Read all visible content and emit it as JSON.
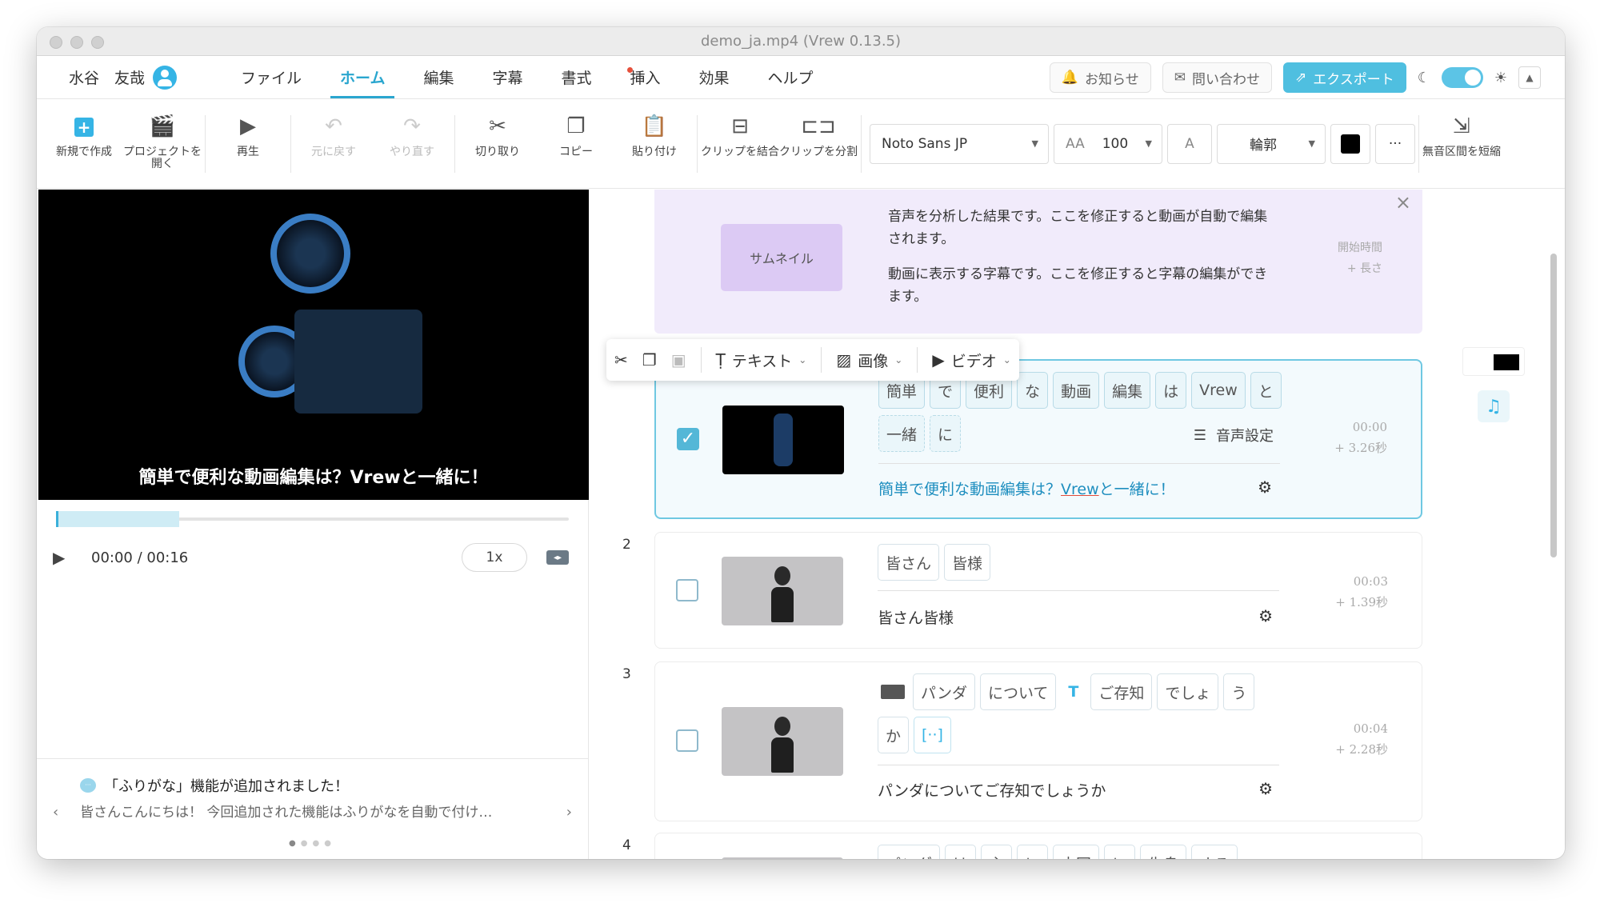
{
  "window": {
    "title": "demo_ja.mp4 (Vrew 0.13.5)"
  },
  "user": {
    "name": "水谷　友哉"
  },
  "menus": [
    "ファイル",
    "ホーム",
    "編集",
    "字幕",
    "書式",
    "挿入",
    "効果",
    "ヘルプ"
  ],
  "header_buttons": {
    "notice": "お知らせ",
    "contact": "問い合わせ",
    "export": "エクスポート"
  },
  "toolbar": {
    "new": "新規で作成",
    "open": "プロジェクトを開く",
    "play": "再生",
    "undo": "元に戻す",
    "redo": "やり直す",
    "cut": "切り取り",
    "copy": "コピー",
    "paste": "貼り付け",
    "merge": "クリップを結合",
    "split": "クリップを分割",
    "font": "Noto Sans JP",
    "size": "100",
    "outline": "輪郭",
    "shorten": "無音区間を短縮"
  },
  "player": {
    "caption": "簡単で便利な動画編集は？Vrewと一緒に！",
    "time": "00:00 / 00:16",
    "speed": "1x",
    "progress": 0.24
  },
  "news": {
    "title": "「ふりがな」機能が追加されました！",
    "body": "皆さんこんにちは！ 今回追加された機能はふりがなを自動で付け…"
  },
  "banner": {
    "thumb_label": "サムネイル",
    "text1": "音声を分析した結果です。ここを修正すると動画が自動で編集されます。",
    "text2": "動画に表示する字幕です。ここを修正すると字幕の編集ができます。",
    "meta1": "開始時間",
    "meta2": "+ 長さ"
  },
  "floatbar": {
    "text": "テキスト",
    "image": "画像",
    "video": "ビデオ"
  },
  "clips": [
    {
      "num": "1",
      "words_row1": [
        "簡単",
        "で",
        "便利",
        "な",
        "動画",
        "編集",
        "は",
        "Vrew",
        "と"
      ],
      "words_row2": [
        "一緒",
        "に"
      ],
      "voice": "音声設定",
      "caption_a": "簡単で便利な動画編集は？",
      "caption_b": "Vrew",
      "caption_c": "と一緒に！",
      "start": "00:00",
      "length": "+ 3.26秒"
    },
    {
      "num": "2",
      "words": [
        "皆さん",
        "皆様"
      ],
      "caption": "皆さん皆様",
      "start": "00:03",
      "length": "+ 1.39秒"
    },
    {
      "num": "3",
      "words_row1": [
        "パンダ",
        "について",
        "ご存知",
        "でしょ",
        "う"
      ],
      "words_row2": [
        "か",
        "[··]"
      ],
      "caption": "パンダについてご存知でしょうか",
      "start": "00:04",
      "length": "+ 2.28秒"
    },
    {
      "num": "4",
      "words": [
        "パンダ",
        "は",
        "主",
        "に",
        "中国",
        "に",
        "生息",
        "する"
      ]
    }
  ],
  "colors": {
    "accent": "#35b4e5",
    "banner": "#f1ebfb",
    "selected_border": "#6fc8e2",
    "font_color": "#000000"
  }
}
